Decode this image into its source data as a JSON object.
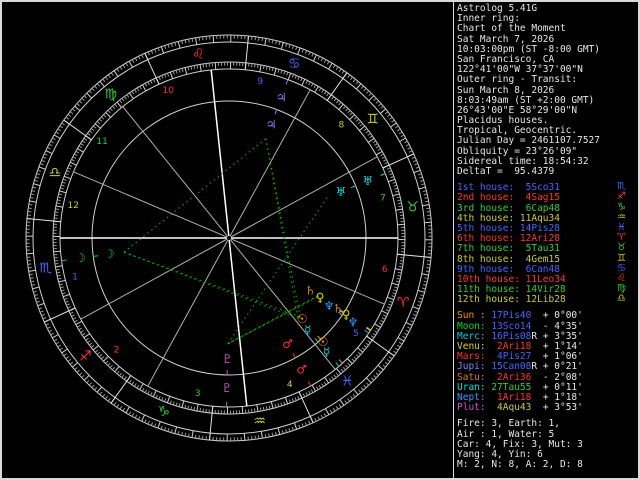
{
  "app": {
    "title": "Astrolog 5.41G"
  },
  "header": [
    "Astrolog 5.41G",
    "Inner ring:",
    "Chart of the Moment",
    "Sat March 7, 2026",
    "10:03:00pm (ST -8:00 GMT)",
    "San Francisco, CA",
    "122°41'00\"W 37°37'00\"N",
    "Outer ring - Transit:",
    "Sun March 8, 2026",
    "8:03:49am (ST +2:00 GMT)",
    "26°43'00\"E 58°29'00\"N",
    "Placidus houses.",
    "Tropical, Geocentric.",
    "Julian Day = 2461107.7527",
    "Obliquity = 23°26'09\"",
    "Sidereal time: 18:54:32",
    "DeltaT =  95.4379"
  ],
  "colors": {
    "background": "#000000",
    "text": "#e6e6e6",
    "frame": "#d9d9d9",
    "elements": {
      "fire": "#ff3333",
      "earth": "#33cc33",
      "air": "#cccc33",
      "water": "#4466ff"
    },
    "planets": {
      "Sun": "#ff9100",
      "Moon": "#00dc00",
      "Merc": "#00cccc",
      "Venu": "#d8d800",
      "Mars": "#ff3030",
      "Jupi": "#8080ff",
      "Satu": "#cc8033",
      "Uran": "#00e0e0",
      "Nept": "#3399ff",
      "Plut": "#cc55cc"
    },
    "aspects": {
      "trine": "#00bb00",
      "sextile": "#00bb00",
      "conj": "#c8c800"
    }
  },
  "signs": [
    {
      "abbr": "Ari",
      "glyph": "♈",
      "element": "fire"
    },
    {
      "abbr": "Tau",
      "glyph": "♉",
      "element": "earth"
    },
    {
      "abbr": "Gem",
      "glyph": "♊",
      "element": "air"
    },
    {
      "abbr": "Can",
      "glyph": "♋",
      "element": "water"
    },
    {
      "abbr": "Leo",
      "glyph": "♌",
      "element": "fire"
    },
    {
      "abbr": "Vir",
      "glyph": "♍",
      "element": "earth"
    },
    {
      "abbr": "Lib",
      "glyph": "♎",
      "element": "air"
    },
    {
      "abbr": "Sco",
      "glyph": "♏",
      "element": "water"
    },
    {
      "abbr": "Sag",
      "glyph": "♐",
      "element": "fire"
    },
    {
      "abbr": "Cap",
      "glyph": "♑",
      "element": "earth"
    },
    {
      "abbr": "Aqu",
      "glyph": "♒",
      "element": "air"
    },
    {
      "abbr": "Pis",
      "glyph": "♓",
      "element": "water"
    }
  ],
  "houses": [
    {
      "num": "1st",
      "cusp": " 5Sco31",
      "sign": "Sco",
      "lon": 215.517
    },
    {
      "num": "2nd",
      "cusp": " 4Sag15",
      "sign": "Sag",
      "lon": 244.25
    },
    {
      "num": "3rd",
      "cusp": " 6Cap48",
      "sign": "Cap",
      "lon": 276.8
    },
    {
      "num": "4th",
      "cusp": "11Aqu34",
      "sign": "Aqu",
      "lon": 311.567
    },
    {
      "num": "5th",
      "cusp": "14Pis28",
      "sign": "Pis",
      "lon": 344.467
    },
    {
      "num": "6th",
      "cusp": "12Ari28",
      "sign": "Ari",
      "lon": 12.467
    },
    {
      "num": "7th",
      "cusp": " 5Tau31",
      "sign": "Tau",
      "lon": 35.517
    },
    {
      "num": "8th",
      "cusp": " 4Gem15",
      "sign": "Gem",
      "lon": 64.25
    },
    {
      "num": "9th",
      "cusp": " 6Can48",
      "sign": "Can",
      "lon": 96.8
    },
    {
      "num": "10th",
      "cusp": "11Leo34",
      "sign": "Leo",
      "lon": 131.567
    },
    {
      "num": "11th",
      "cusp": "14Vir28",
      "sign": "Vir",
      "lon": 164.467
    },
    {
      "num": "12th",
      "cusp": "12Lib28",
      "sign": "Lib",
      "lon": 192.467
    }
  ],
  "planets": [
    {
      "name": "Sun",
      "glyph": "☉",
      "pos": "17Pis40",
      "sign": "Pis",
      "retro": false,
      "lat": "+ 0°00'",
      "lon": 347.667
    },
    {
      "name": "Moon",
      "glyph": "☽",
      "pos": "13Sco14",
      "sign": "Sco",
      "retro": false,
      "lat": "- 4°35'",
      "lon": 223.233
    },
    {
      "name": "Merc",
      "glyph": "☿",
      "pos": "16Pis08",
      "sign": "Pis",
      "retro": true,
      "lat": "+ 3°35'",
      "lon": 346.133
    },
    {
      "name": "Venu",
      "glyph": "♀",
      "pos": " 2Ari18",
      "sign": "Ari",
      "retro": false,
      "lat": "+ 1°14'",
      "lon": 2.3
    },
    {
      "name": "Mars",
      "glyph": "♂",
      "pos": " 4Pis27",
      "sign": "Pis",
      "retro": false,
      "lat": "+ 1°06'",
      "lon": 334.45
    },
    {
      "name": "Jupi",
      "glyph": "♃",
      "pos": "15Can08",
      "sign": "Can",
      "retro": true,
      "lat": "+ 0°21'",
      "lon": 105.133
    },
    {
      "name": "Satu",
      "glyph": "♄",
      "pos": " 2Ari36",
      "sign": "Ari",
      "retro": false,
      "lat": "- 2°08'",
      "lon": 2.6
    },
    {
      "name": "Uran",
      "glyph": "♅",
      "pos": "27Tau55",
      "sign": "Tau",
      "retro": false,
      "lat": "+ 0°11'",
      "lon": 57.917
    },
    {
      "name": "Nept",
      "glyph": "♆",
      "pos": " 1Ari18",
      "sign": "Ari",
      "retro": false,
      "lat": "+ 1°18'",
      "lon": 1.3
    },
    {
      "name": "Plut",
      "glyph": "♇",
      "pos": " 4Aqu43",
      "sign": "Aqu",
      "retro": false,
      "lat": "+ 3°53'",
      "lon": 304.717
    }
  ],
  "aspects": [
    {
      "p1": "Sun",
      "p2": "Moon",
      "type": "trine"
    },
    {
      "p1": "Sun",
      "p2": "Jupi",
      "type": "trine"
    },
    {
      "p1": "Moon",
      "p2": "Merc",
      "type": "trine"
    },
    {
      "p1": "Moon",
      "p2": "Jupi",
      "type": "trine"
    },
    {
      "p1": "Jupi",
      "p2": "Merc",
      "type": "trine"
    },
    {
      "p1": "Uran",
      "p2": "Plut",
      "type": "trine"
    },
    {
      "p1": "Venu",
      "p2": "Plut",
      "type": "sextile"
    },
    {
      "p1": "Satu",
      "p2": "Plut",
      "type": "sextile"
    },
    {
      "p1": "Nept",
      "p2": "Plut",
      "type": "sextile"
    },
    {
      "p1": "Sun",
      "p2": "Merc",
      "type": "conj"
    },
    {
      "p1": "Venu",
      "p2": "Satu",
      "type": "conj"
    },
    {
      "p1": "Venu",
      "p2": "Nept",
      "type": "conj"
    },
    {
      "p1": "Satu",
      "p2": "Nept",
      "type": "conj"
    }
  ],
  "summary": [
    "Fire: 3, Earth: 1,",
    "Air : 1, Water: 5",
    "Car: 4, Fix: 3, Mut: 3",
    "Yang: 4, Yin: 6",
    "M: 2, N: 8, A: 2, D: 8"
  ],
  "wheel": {
    "asc_lon": 215.517,
    "label": "dual ring wheel: inner natal, outer transit"
  }
}
